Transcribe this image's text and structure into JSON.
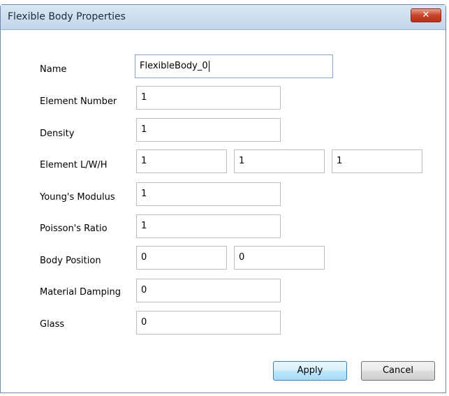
{
  "window": {
    "title": "Flexible Body Properties",
    "close_label": "✕"
  },
  "form": {
    "name": {
      "label": "Name",
      "value": "FlexibleBody_0"
    },
    "element_number": {
      "label": "Element Number",
      "value": "1"
    },
    "density": {
      "label": "Density",
      "value": "1"
    },
    "element_lwh": {
      "label": "Element L/W/H",
      "l": "1",
      "w": "1",
      "h": "1"
    },
    "youngs_modulus": {
      "label": "Young's Modulus",
      "value": "1"
    },
    "poissons_ratio": {
      "label": "Poisson's Ratio",
      "value": "1"
    },
    "body_position": {
      "label": "Body Position",
      "x": "0",
      "y": "0"
    },
    "material_damping": {
      "label": "Material Damping",
      "value": "0"
    },
    "glass": {
      "label": "Glass",
      "value": "0"
    }
  },
  "buttons": {
    "apply": "Apply",
    "cancel": "Cancel"
  }
}
